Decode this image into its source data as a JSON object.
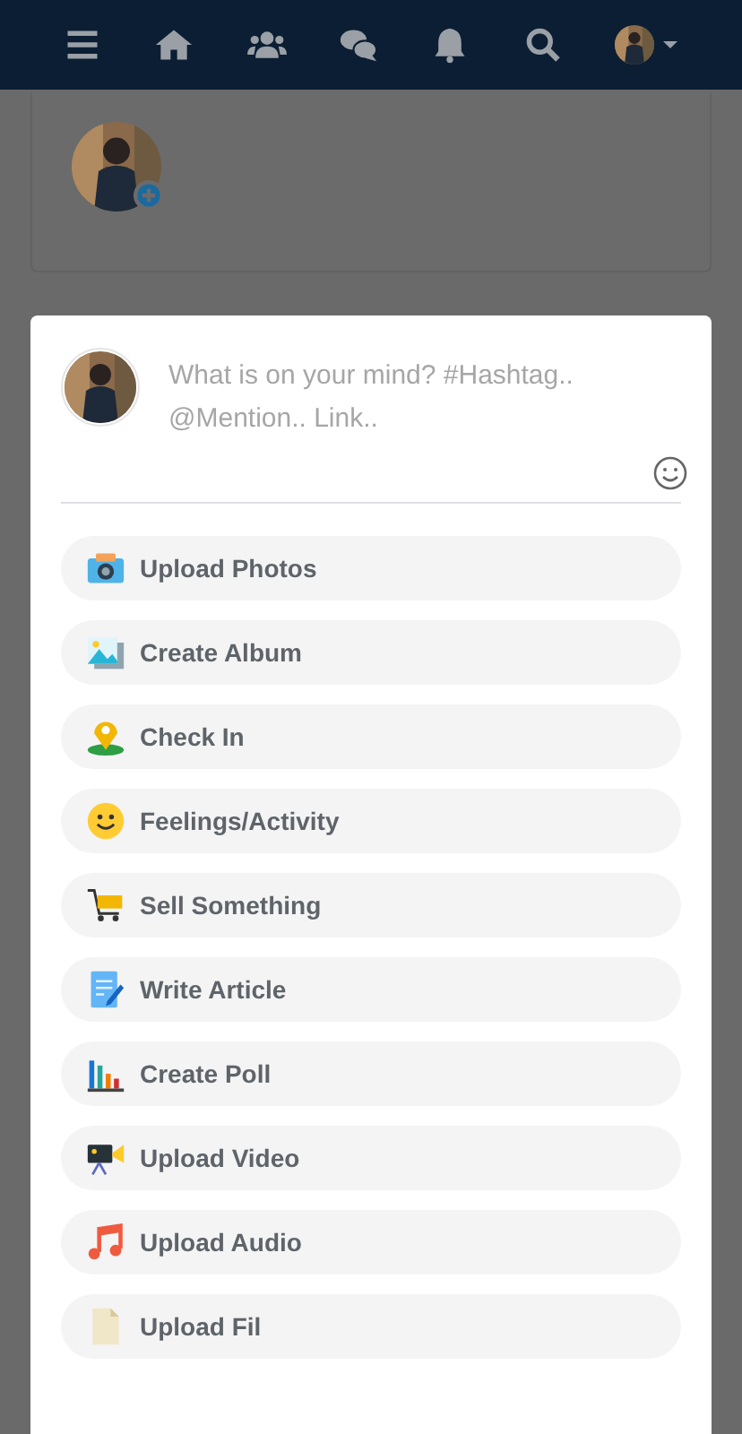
{
  "composer": {
    "placeholder": "What is on your mind? #Hashtag.. @Mention.. Link.."
  },
  "options": [
    {
      "kind": "camera",
      "label": "Upload Photos"
    },
    {
      "kind": "album",
      "label": "Create Album"
    },
    {
      "kind": "pin",
      "label": "Check In"
    },
    {
      "kind": "smiley",
      "label": "Feelings/Activity"
    },
    {
      "kind": "cart",
      "label": "Sell Something"
    },
    {
      "kind": "article",
      "label": "Write Article"
    },
    {
      "kind": "poll",
      "label": "Create Poll"
    },
    {
      "kind": "video",
      "label": "Upload Video"
    },
    {
      "kind": "audio",
      "label": "Upload Audio"
    },
    {
      "kind": "file",
      "label": "Upload Fil"
    }
  ]
}
